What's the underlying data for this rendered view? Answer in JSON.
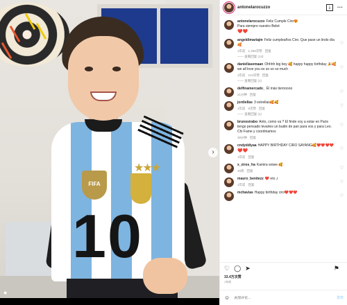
{
  "post": {
    "username": "antonelarocuzzo",
    "caption": {
      "username": "antonelarocuzzo",
      "text_line1": "Feliz Cumple Ciro😍",
      "text_line2": "Para siempre nuestro Bebé",
      "hearts": "❤️❤️"
    },
    "photo": {
      "shirt_number": "10",
      "badge_text": "FIFA"
    },
    "comments": [
      {
        "username": "angeldimariajm",
        "text": "Feliz cumpleaños Ciro. Que pase un lindo día 🥰",
        "time": "1年前",
        "likes": "1,258次赞",
        "reply": "回复",
        "view_replies": "—— 查看回复 (14)"
      },
      {
        "username": "daniellasemaan",
        "text": "Ohhhh big boy 🥰 happy happy birthday 🎉🥰 we all love you so so so so much",
        "time": "1年前",
        "likes": "213次赞",
        "reply": "回复",
        "view_replies": "—— 查看回复 (1)"
      },
      {
        "username": "delfinamercado_",
        "text": "Él más tiernoooo",
        "time": "21分钟",
        "likes": "",
        "reply": "回复",
        "view_replies": ""
      },
      {
        "username": "jordiellas",
        "text": "3 estrellas🥰🥰",
        "time": "1年前",
        "likes": "9次赞",
        "reply": "回复",
        "view_replies": "—— 查看回复 (1)"
      },
      {
        "username": "brunosirabo",
        "text": "Anto, como va ? El finde voy a estar en Paris tengo pensado levarles un budin de pan para vos y para Leo. Chi Fame y coordinamos",
        "time": "38分钟",
        "likes": "",
        "reply": "回复",
        "view_replies": ""
      },
      {
        "username": "cndyddiyaa",
        "text": "HAPPY BIRTHDAY CIRO SAYANG🥰❤️❤️❤️❤️",
        "text2": "❤️❤️",
        "time": "1年前",
        "likes": "",
        "reply": "回复",
        "view_replies": ""
      },
      {
        "username": "x_ziros_ha",
        "text": "Kamira wowe 🥰",
        "time": "46周",
        "likes": "",
        "reply": "回复",
        "view_replies": ""
      },
      {
        "username": "mauro_benitezz",
        "text": "❤️ eto ,r",
        "time": "1年前",
        "likes": "",
        "reply": "回复",
        "view_replies": ""
      },
      {
        "username": "mchavias",
        "text": "Happy birthday ciro❤️❤️❤️",
        "time": "",
        "likes": "",
        "reply": "",
        "view_replies": ""
      }
    ],
    "likes_count": "33.4万次赞",
    "time_ago": "1年前",
    "add_comment_placeholder": "添加评论...",
    "post_button": "发布"
  },
  "icons": {
    "heart": "heart-icon",
    "comment": "comment-icon",
    "share": "share-icon",
    "save": "bookmark-icon",
    "more": "more-options-icon",
    "emoji": "emoji-icon",
    "next": "chevron-right-icon",
    "tag": "user-tag-icon"
  },
  "colors": {
    "mention": "#00376b",
    "heart_red": "#ed4956",
    "muted": "#8e8e8e",
    "post_btn": "#b2dffc"
  }
}
